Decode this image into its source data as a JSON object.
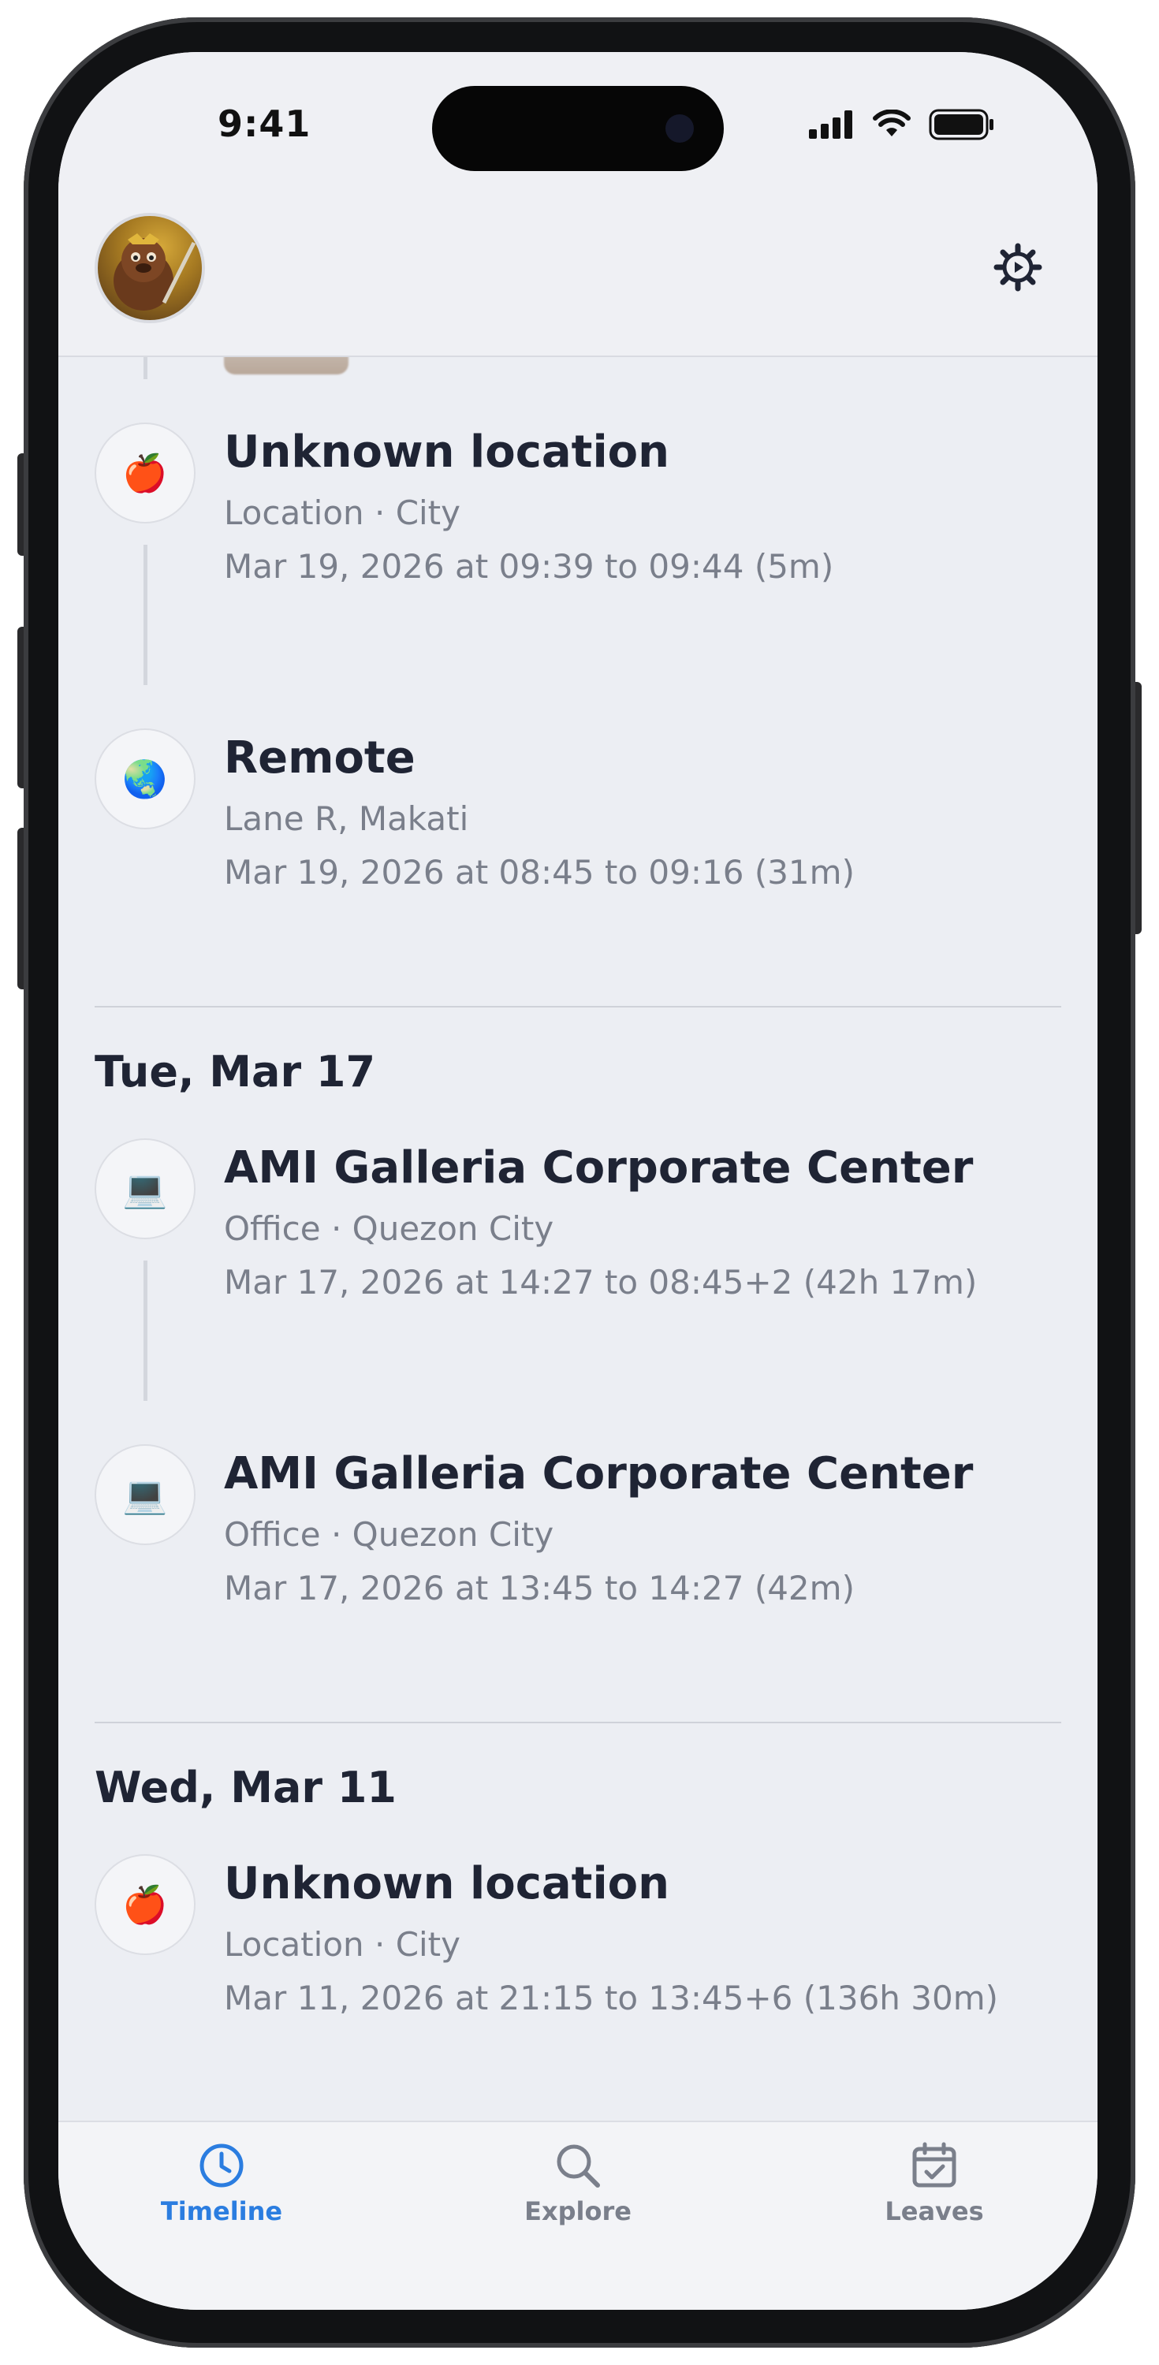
{
  "status_bar": {
    "time": "9:41"
  },
  "header": {
    "avatar": "avatar",
    "settings_icon": "gear-icon"
  },
  "timeline": {
    "entries_group_1": [
      {
        "icon": "🍎",
        "title": "Unknown location",
        "subtitle": "Location · City",
        "time": "Mar 19, 2026 at 09:39 to 09:44 (5m)"
      },
      {
        "icon": "🌏",
        "title": "Remote",
        "subtitle": "Lane R, Makati",
        "time": "Mar 19, 2026 at 08:45 to 09:16 (31m)"
      }
    ],
    "section_2": {
      "date": "Tue, Mar 17",
      "entries": [
        {
          "icon": "💻",
          "title": "AMI Galleria Corporate Center",
          "subtitle": "Office · Quezon City",
          "time": "Mar 17, 2026 at 14:27 to 08:45+2 (42h 17m)"
        },
        {
          "icon": "💻",
          "title": "AMI Galleria Corporate Center",
          "subtitle": "Office · Quezon City",
          "time": "Mar 17, 2026 at 13:45 to 14:27 (42m)"
        }
      ]
    },
    "section_3": {
      "date": "Wed, Mar 11",
      "entries": [
        {
          "icon": "🍎",
          "title": "Unknown location",
          "subtitle": "Location · City",
          "time": "Mar 11, 2026 at 21:15 to 13:45+6 (136h 30m)"
        }
      ]
    }
  },
  "tabbar": {
    "tabs": [
      {
        "label": "Timeline",
        "icon": "clock-icon",
        "active": true
      },
      {
        "label": "Explore",
        "icon": "search-icon",
        "active": false
      },
      {
        "label": "Leaves",
        "icon": "calendar-check-icon",
        "active": false
      }
    ]
  },
  "colors": {
    "accent": "#2b7de0",
    "inactive": "#7a7f8b",
    "title_text": "#1f2434",
    "screen_bg": "#eceef3"
  }
}
